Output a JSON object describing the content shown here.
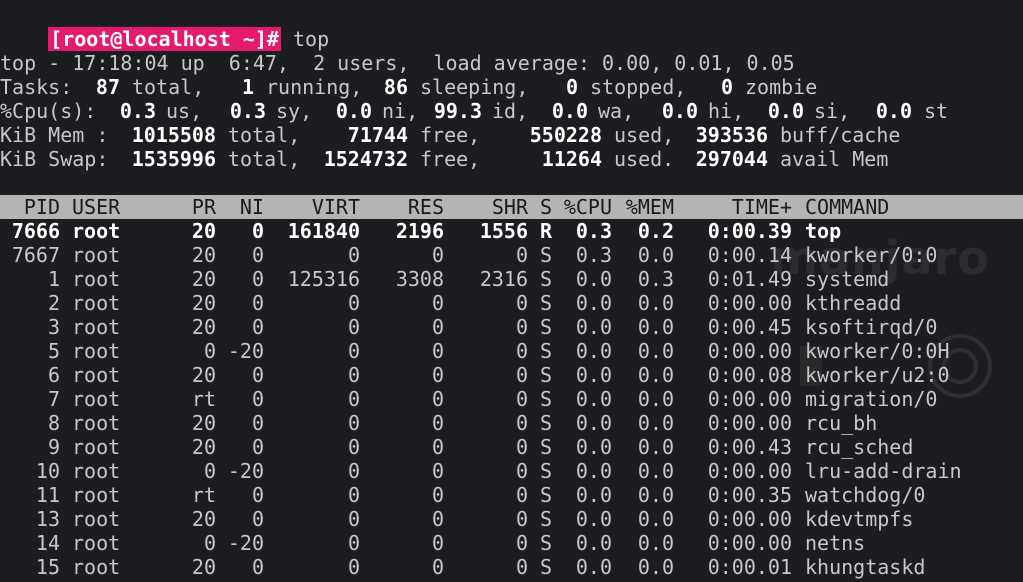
{
  "prompt": {
    "badge": "[root@localhost ~]#",
    "command": "top"
  },
  "summary": {
    "line1": "top - 17:18:04 up  6:47,  2 users,  load average: 0.00, 0.01, 0.05",
    "tasks": {
      "label": "Tasks:",
      "total": "87",
      "total_label": "total,",
      "running": "1",
      "running_label": "running,",
      "sleeping": "86",
      "sleeping_label": "sleeping,",
      "stopped": "0",
      "stopped_label": "stopped,",
      "zombie": "0",
      "zombie_label": "zombie"
    },
    "cpu": {
      "label": "%Cpu(s):",
      "us": "0.3",
      "us_label": "us,",
      "sy": "0.3",
      "sy_label": "sy,",
      "ni": "0.0",
      "ni_label": "ni,",
      "id": "99.3",
      "id_label": "id,",
      "wa": "0.0",
      "wa_label": "wa,",
      "hi": "0.0",
      "hi_label": "hi,",
      "si": "0.0",
      "si_label": "si,",
      "st": "0.0",
      "st_label": "st"
    },
    "mem": {
      "label": "KiB Mem :",
      "total": "1015508",
      "total_label": "total,",
      "free": "71744",
      "free_label": "free,",
      "used": "550228",
      "used_label": "used,",
      "cache": "393536",
      "cache_label": "buff/cache"
    },
    "swap": {
      "label": "KiB Swap:",
      "total": "1535996",
      "total_label": "total,",
      "free": "1524732",
      "free_label": "free,",
      "used": "11264",
      "used_label": "used.",
      "avail": "297044",
      "avail_label": "avail Mem"
    }
  },
  "columns": [
    "PID",
    "USER",
    "PR",
    "NI",
    "VIRT",
    "RES",
    "SHR",
    "S",
    "%CPU",
    "%MEM",
    "TIME+",
    "COMMAND"
  ],
  "processes": [
    {
      "pid": "7666",
      "user": "root",
      "pr": "20",
      "ni": "0",
      "virt": "161840",
      "res": "2196",
      "shr": "1556",
      "s": "R",
      "cpu": "0.3",
      "mem": "0.2",
      "time": "0:00.39",
      "command": "top",
      "selected": true
    },
    {
      "pid": "7667",
      "user": "root",
      "pr": "20",
      "ni": "0",
      "virt": "0",
      "res": "0",
      "shr": "0",
      "s": "S",
      "cpu": "0.3",
      "mem": "0.0",
      "time": "0:00.14",
      "command": "kworker/0:0"
    },
    {
      "pid": "1",
      "user": "root",
      "pr": "20",
      "ni": "0",
      "virt": "125316",
      "res": "3308",
      "shr": "2316",
      "s": "S",
      "cpu": "0.0",
      "mem": "0.3",
      "time": "0:01.49",
      "command": "systemd"
    },
    {
      "pid": "2",
      "user": "root",
      "pr": "20",
      "ni": "0",
      "virt": "0",
      "res": "0",
      "shr": "0",
      "s": "S",
      "cpu": "0.0",
      "mem": "0.0",
      "time": "0:00.00",
      "command": "kthreadd"
    },
    {
      "pid": "3",
      "user": "root",
      "pr": "20",
      "ni": "0",
      "virt": "0",
      "res": "0",
      "shr": "0",
      "s": "S",
      "cpu": "0.0",
      "mem": "0.0",
      "time": "0:00.45",
      "command": "ksoftirqd/0"
    },
    {
      "pid": "5",
      "user": "root",
      "pr": "0",
      "ni": "-20",
      "virt": "0",
      "res": "0",
      "shr": "0",
      "s": "S",
      "cpu": "0.0",
      "mem": "0.0",
      "time": "0:00.00",
      "command": "kworker/0:0H"
    },
    {
      "pid": "6",
      "user": "root",
      "pr": "20",
      "ni": "0",
      "virt": "0",
      "res": "0",
      "shr": "0",
      "s": "S",
      "cpu": "0.0",
      "mem": "0.0",
      "time": "0:00.08",
      "command": "kworker/u2:0"
    },
    {
      "pid": "7",
      "user": "root",
      "pr": "rt",
      "ni": "0",
      "virt": "0",
      "res": "0",
      "shr": "0",
      "s": "S",
      "cpu": "0.0",
      "mem": "0.0",
      "time": "0:00.00",
      "command": "migration/0"
    },
    {
      "pid": "8",
      "user": "root",
      "pr": "20",
      "ni": "0",
      "virt": "0",
      "res": "0",
      "shr": "0",
      "s": "S",
      "cpu": "0.0",
      "mem": "0.0",
      "time": "0:00.00",
      "command": "rcu_bh"
    },
    {
      "pid": "9",
      "user": "root",
      "pr": "20",
      "ni": "0",
      "virt": "0",
      "res": "0",
      "shr": "0",
      "s": "S",
      "cpu": "0.0",
      "mem": "0.0",
      "time": "0:00.43",
      "command": "rcu_sched"
    },
    {
      "pid": "10",
      "user": "root",
      "pr": "0",
      "ni": "-20",
      "virt": "0",
      "res": "0",
      "shr": "0",
      "s": "S",
      "cpu": "0.0",
      "mem": "0.0",
      "time": "0:00.00",
      "command": "lru-add-drain"
    },
    {
      "pid": "11",
      "user": "root",
      "pr": "rt",
      "ni": "0",
      "virt": "0",
      "res": "0",
      "shr": "0",
      "s": "S",
      "cpu": "0.0",
      "mem": "0.0",
      "time": "0:00.35",
      "command": "watchdog/0"
    },
    {
      "pid": "13",
      "user": "root",
      "pr": "20",
      "ni": "0",
      "virt": "0",
      "res": "0",
      "shr": "0",
      "s": "S",
      "cpu": "0.0",
      "mem": "0.0",
      "time": "0:00.00",
      "command": "kdevtmpfs"
    },
    {
      "pid": "14",
      "user": "root",
      "pr": "0",
      "ni": "-20",
      "virt": "0",
      "res": "0",
      "shr": "0",
      "s": "S",
      "cpu": "0.0",
      "mem": "0.0",
      "time": "0:00.00",
      "command": "netns"
    },
    {
      "pid": "15",
      "user": "root",
      "pr": "20",
      "ni": "0",
      "virt": "0",
      "res": "0",
      "shr": "0",
      "s": "S",
      "cpu": "0.0",
      "mem": "0.0",
      "time": "0:00.01",
      "command": "khungtaskd"
    }
  ],
  "watermark": "manjaro",
  "colors": {
    "background": "#1c1d20",
    "text": "#c8c8c8",
    "bold_text": "#ffffff",
    "prompt_badge": "#e5196e",
    "header_bar": "#b4b4b4"
  }
}
